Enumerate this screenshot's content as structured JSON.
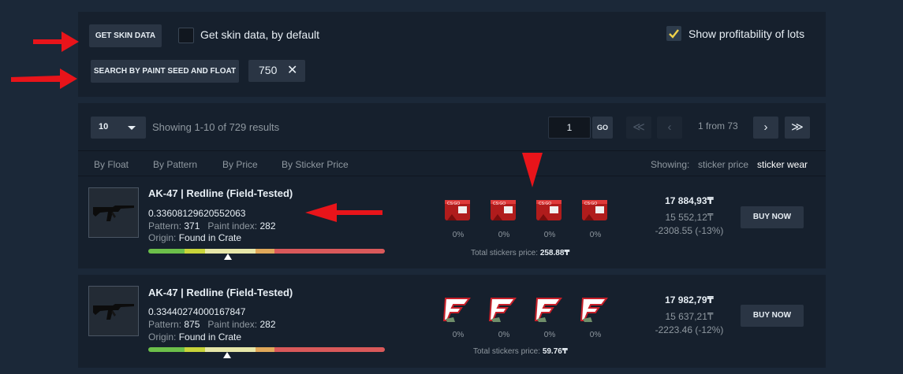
{
  "filters": {
    "get_skin_data": "GET SKIN DATA",
    "default_label": "Get skin data, by default",
    "profit_label": "Show profitability of lots",
    "search_seed": "SEARCH BY PAINT SEED AND FLOAT",
    "chip_value": "750",
    "chip_close": "✕",
    "profit_checked": true,
    "default_checked": false
  },
  "toolbar": {
    "page_size": "10",
    "showing": "Showing 1-10 of 729 results",
    "page_value": "1",
    "go": "GO",
    "first": "≪",
    "prev": "‹",
    "page_info": "1 from 73",
    "next": "›",
    "last": "≫"
  },
  "sort": {
    "by_float": "By Float",
    "by_pattern": "By Pattern",
    "by_price": "By Price",
    "by_sticker_price": "By Sticker Price",
    "showing_label": "Showing:",
    "sticker_price": "sticker price",
    "sticker_wear": "sticker wear"
  },
  "colors": {
    "accent_check": "#f0d24a",
    "arrow": "#e8141a",
    "wear": [
      "#6cbf4a",
      "#c8d43a",
      "#e6e6a8",
      "#e0a85a",
      "#d9595a"
    ]
  },
  "items": [
    {
      "name": "AK-47 | Redline (Field-Tested)",
      "float": "0.33608129620552063",
      "pattern_label": "Pattern:",
      "pattern": "371",
      "paint_label": "Paint index:",
      "paint": "282",
      "origin_label": "Origin:",
      "origin": "Found in Crate",
      "wear_position": 0.336,
      "stickers": [
        {
          "icon": "cs-sticker-icon",
          "wear": "0%"
        },
        {
          "icon": "cs-sticker-icon",
          "wear": "0%"
        },
        {
          "icon": "cs-sticker-icon",
          "wear": "0%"
        },
        {
          "icon": "cs-sticker-icon",
          "wear": "0%"
        }
      ],
      "total_label": "Total stickers price:",
      "total": "258.88₸",
      "price": "17 884,93₸",
      "price_ref": "15 552,12₸",
      "profit": "-2308.55 (-13%)",
      "buy": "BUY NOW"
    },
    {
      "name": "AK-47 | Redline (Field-Tested)",
      "float": "0.33440274000167847",
      "pattern_label": "Pattern:",
      "pattern": "875",
      "paint_label": "Paint index:",
      "paint": "282",
      "origin_label": "Origin:",
      "origin": "Found in Crate",
      "wear_position": 0.334,
      "stickers": [
        {
          "icon": "faze-sticker-icon",
          "wear": "0%"
        },
        {
          "icon": "faze-sticker-icon",
          "wear": "0%"
        },
        {
          "icon": "faze-sticker-icon",
          "wear": "0%"
        },
        {
          "icon": "faze-sticker-icon",
          "wear": "0%"
        }
      ],
      "total_label": "Total stickers price:",
      "total": "59.76₸",
      "price": "17 982,79₸",
      "price_ref": "15 637,21₸",
      "profit": "-2223.46 (-12%)",
      "buy": "BUY NOW"
    }
  ]
}
